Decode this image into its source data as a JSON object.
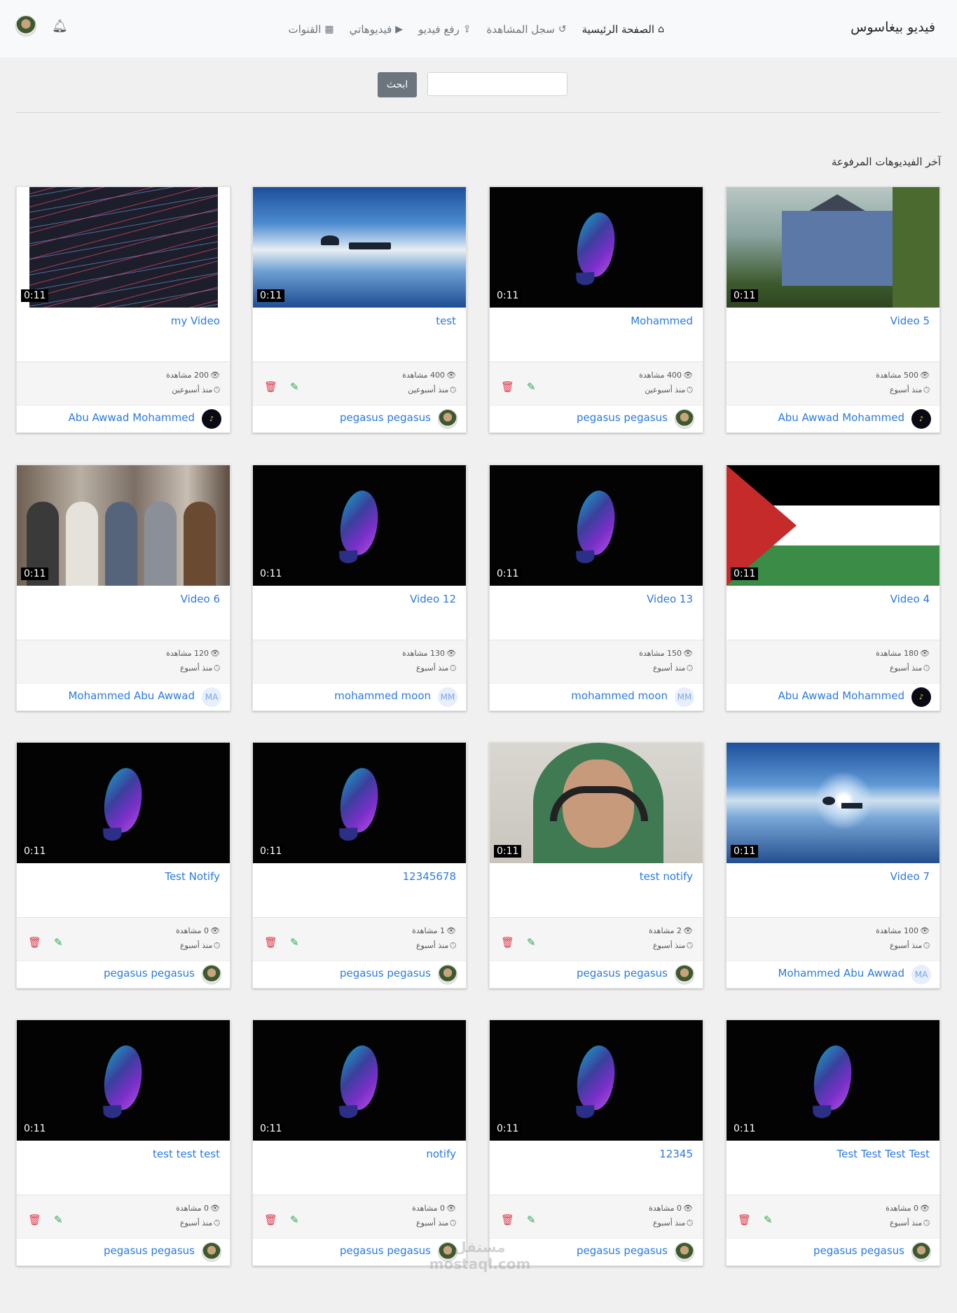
{
  "navbar": {
    "brand": "فيديو بيغاسوس",
    "links": [
      {
        "label": "الصفحة الرئيسية",
        "icon": "home-icon",
        "active": true
      },
      {
        "label": "سجل المشاهدة",
        "icon": "history-icon",
        "active": false
      },
      {
        "label": "رفع فيديو",
        "icon": "upload-icon",
        "active": false
      },
      {
        "label": "فيديوهاتي",
        "icon": "play-circle-icon",
        "active": false
      },
      {
        "label": "القنوات",
        "icon": "film-icon",
        "active": false
      }
    ]
  },
  "search": {
    "placeholder": "",
    "value": "",
    "button_label": "ابحث"
  },
  "section_title": "آخر الفيديوهات المرفوعة",
  "videos": [
    {
      "title": "Video 5",
      "duration": "0:11",
      "views": "500 مشاهدة",
      "date": "منذ أسبوع",
      "owner": "Abu Awwad Mohammed",
      "owner_avatar": "dark",
      "thumb": "house",
      "editable": false
    },
    {
      "title": "Mohammed",
      "duration": "0:11",
      "views": "400 مشاهدة",
      "date": "منذ أسبوعين",
      "owner": "pegasus pegasus",
      "owner_avatar": "photo",
      "thumb": "groot",
      "editable": true
    },
    {
      "title": "test",
      "duration": "0:11",
      "views": "400 مشاهدة",
      "date": "منذ أسبوعين",
      "owner": "pegasus pegasus",
      "owner_avatar": "photo",
      "thumb": "sky",
      "editable": true
    },
    {
      "title": "my Video",
      "duration": "0:11",
      "views": "200 مشاهدة",
      "date": "منذ أسبوعين",
      "owner": "Abu Awwad Mohammed",
      "owner_avatar": "dark",
      "thumb": "code",
      "editable": false
    },
    {
      "title": "Video 4",
      "duration": "0:11",
      "views": "180 مشاهدة",
      "date": "منذ أسبوع",
      "owner": "Abu Awwad Mohammed",
      "owner_avatar": "dark",
      "thumb": "flag",
      "editable": false
    },
    {
      "title": "Video 13",
      "duration": "0:11",
      "views": "150 مشاهدة",
      "date": "منذ أسبوع",
      "owner": "mohammed moon",
      "owner_avatar": "MM",
      "thumb": "groot",
      "editable": false
    },
    {
      "title": "Video 12",
      "duration": "0:11",
      "views": "130 مشاهدة",
      "date": "منذ أسبوع",
      "owner": "mohammed moon",
      "owner_avatar": "MM",
      "thumb": "groot",
      "editable": false
    },
    {
      "title": "Video 6",
      "duration": "0:11",
      "views": "120 مشاهدة",
      "date": "منذ أسبوع",
      "owner": "Mohammed Abu Awwad",
      "owner_avatar": "MA",
      "thumb": "band",
      "editable": false
    },
    {
      "title": "Video 7",
      "duration": "0:11",
      "views": "100 مشاهدة",
      "date": "منذ أسبوع",
      "owner": "Mohammed Abu Awwad",
      "owner_avatar": "MA",
      "thumb": "sky2",
      "editable": false
    },
    {
      "title": "test notify",
      "duration": "0:11",
      "views": "2 مشاهدة",
      "date": "منذ أسبوع",
      "owner": "pegasus pegasus",
      "owner_avatar": "photo",
      "thumb": "man",
      "editable": true
    },
    {
      "title": "12345678",
      "duration": "0:11",
      "views": "1 مشاهدة",
      "date": "منذ أسبوع",
      "owner": "pegasus pegasus",
      "owner_avatar": "photo",
      "thumb": "groot",
      "editable": true
    },
    {
      "title": "Test Notify",
      "duration": "0:11",
      "views": "0 مشاهدة",
      "date": "منذ أسبوع",
      "owner": "pegasus pegasus",
      "owner_avatar": "photo",
      "thumb": "groot",
      "editable": true
    },
    {
      "title": "Test Test Test Test",
      "duration": "0:11",
      "views": "0 مشاهدة",
      "date": "منذ أسبوع",
      "owner": "pegasus pegasus",
      "owner_avatar": "photo",
      "thumb": "groot",
      "editable": true
    },
    {
      "title": "12345",
      "duration": "0:11",
      "views": "0 مشاهدة",
      "date": "منذ أسبوع",
      "owner": "pegasus pegasus",
      "owner_avatar": "photo",
      "thumb": "groot",
      "editable": true
    },
    {
      "title": "notify",
      "duration": "0:11",
      "views": "0 مشاهدة",
      "date": "منذ أسبوع",
      "owner": "pegasus pegasus",
      "owner_avatar": "photo",
      "thumb": "groot",
      "editable": true
    },
    {
      "title": "test test test",
      "duration": "0:11",
      "views": "0 مشاهدة",
      "date": "منذ أسبوع",
      "owner": "pegasus pegasus",
      "owner_avatar": "photo",
      "thumb": "groot",
      "editable": true
    }
  ],
  "watermark": "مستقل mostaql.com",
  "colors": {
    "link": "#2a7ae2",
    "delete": "#dc3545",
    "edit": "#28a745",
    "button": "#6c757d"
  }
}
